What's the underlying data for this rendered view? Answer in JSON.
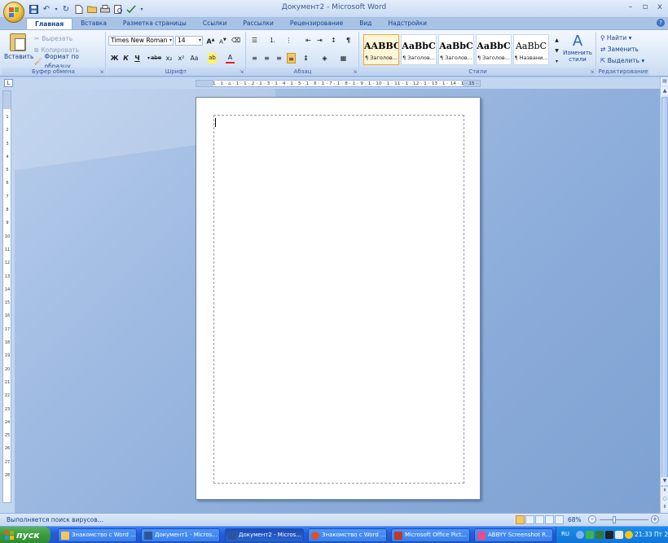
{
  "window": {
    "title": "Документ2 - Microsoft Word",
    "minimize": "–",
    "restore": "▫",
    "close": "x"
  },
  "tabs": [
    {
      "label": "Главная",
      "active": true
    },
    {
      "label": "Вставка"
    },
    {
      "label": "Разметка страницы"
    },
    {
      "label": "Ссылки"
    },
    {
      "label": "Рассылки"
    },
    {
      "label": "Рецензирование"
    },
    {
      "label": "Вид"
    },
    {
      "label": "Надстройки"
    }
  ],
  "clipboard": {
    "paste_label": "Вставить",
    "cut_label": "Вырезать",
    "copy_label": "Копировать",
    "format_painter_label": "Формат по образцу",
    "group_label": "Буфер обмена"
  },
  "font": {
    "font_name": "Times New Roman",
    "font_size": "14",
    "grow_label": "A",
    "shrink_label": "A",
    "bold": "Ж",
    "italic": "К",
    "underline": "Ч",
    "strike": "abe",
    "subscript": "x₂",
    "superscript": "x²",
    "case": "Aa",
    "highlight": "ab",
    "font_color": "A",
    "group_label": "Шрифт"
  },
  "paragraph": {
    "group_label": "Абзац"
  },
  "styles": {
    "tiles": [
      {
        "sample": "AABBC",
        "name": "¶ Заголов..."
      },
      {
        "sample": "AaBbC",
        "name": "¶ Заголов..."
      },
      {
        "sample": "AaBbC",
        "name": "¶ Заголов..."
      },
      {
        "sample": "AaBbC",
        "name": "¶ Заголов..."
      },
      {
        "sample": "AaBbC",
        "name": "¶ Названи..."
      }
    ],
    "change_label_1": "Изменить",
    "change_label_2": "стили",
    "group_label": "Стили"
  },
  "editing": {
    "find_label": "Найти",
    "replace_label": "Заменить",
    "select_label": "Выделить",
    "group_label": "Редактирование"
  },
  "ruler": {
    "horizontal_numbers": "1 · 1 · ⌂ · 1 · 1 · 2 · 1 · 3 · 1 · 4 · 1 · 5 · 1 · 6 · 1 · 7 · 1 · 8 · 1 · 9 · 1 · 10 · 1 · 11 · 1 · 12 · 1 · 13 · 1 · 14 · 1 · 15 · 1 · 16 · 1 · 17 · 1 · 18 · 1 · 19",
    "vertical_numbers": [
      "1",
      "2",
      "3",
      "4",
      "5",
      "6",
      "7",
      "8",
      "9",
      "10",
      "11",
      "12",
      "13",
      "14",
      "15",
      "16",
      "17",
      "18",
      "19",
      "20",
      "21",
      "22",
      "23",
      "24",
      "25",
      "26",
      "27",
      "28"
    ]
  },
  "status": {
    "text": "Выполняется поиск вирусов...",
    "zoom": "68%",
    "zoom_minus": "–",
    "zoom_plus": "+"
  },
  "taskbar": {
    "start_label": "пуск",
    "buttons": [
      {
        "label": "Знакомство с Word ..."
      },
      {
        "label": "Документ1 - Micros..."
      },
      {
        "label": "Документ2 - Micros...",
        "active": true
      },
      {
        "label": "Знакомство с Word ..."
      },
      {
        "label": "Microsoft Office Pict..."
      },
      {
        "label": "ABBYY Screenshot R..."
      }
    ],
    "language": "RU",
    "clock": "21:33 Пт 2"
  },
  "colors": {
    "ribbon_text": "#15428b",
    "doc_background": "#8eaedb",
    "taskbar": "#245edb",
    "start_button": "#3a9a3d"
  }
}
